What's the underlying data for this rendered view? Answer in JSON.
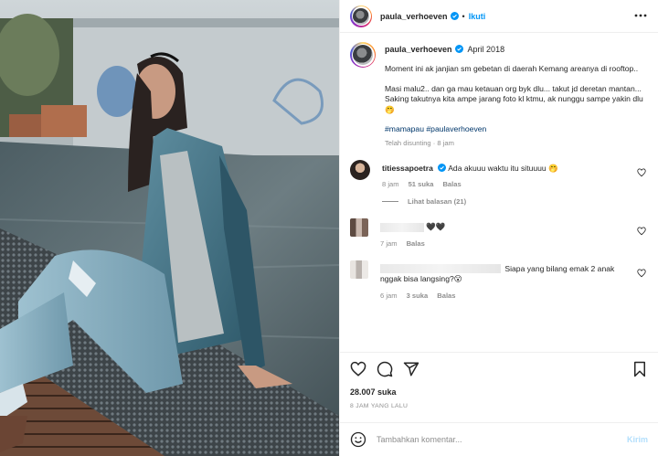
{
  "header": {
    "username": "paula_verhoeven",
    "separator": "•",
    "follow_label": "Ikuti"
  },
  "caption": {
    "username": "paula_verhoeven",
    "date": "April 2018",
    "paragraphs": [
      "Moment ini ak janjian sm gebetan di daerah Kemang areanya di rooftop..",
      "Masi malu2.. dan ga mau ketauan org byk dlu... takut jd deretan mantan...\nSaking takutnya kita ampe jarang foto kl ktmu, ak nunggu sampe yakin dlu 🤭"
    ],
    "hashtags": "#mamapau #paulaverhoeven",
    "meta": "Telah disunting · 8 jam"
  },
  "comments": [
    {
      "username": "titiessapoetra",
      "text": "Ada akuuu waktu itu situuuu 🤭",
      "time": "8 jam",
      "likes": "51 suka",
      "reply": "Balas",
      "view_replies": "Lihat balasan (21)"
    },
    {
      "username": "",
      "text": "🖤🖤",
      "time": "7 jam",
      "reply": "Balas"
    },
    {
      "username": "",
      "text": "Siapa yang bilang emak 2 anak nggak bisa langsing?😮",
      "time": "6 jam",
      "likes": "3 suka",
      "reply": "Balas"
    }
  ],
  "actions": {
    "likes": "28.007 suka",
    "time_ago": "8 JAM YANG LALU"
  },
  "add_comment": {
    "placeholder": "Tambahkan komentar...",
    "post_label": "Kirim"
  },
  "colors": {
    "link_blue": "#0095f6",
    "hashtag": "#00376b",
    "muted": "#8e8e8e",
    "post_disabled": "#b2dffc"
  }
}
